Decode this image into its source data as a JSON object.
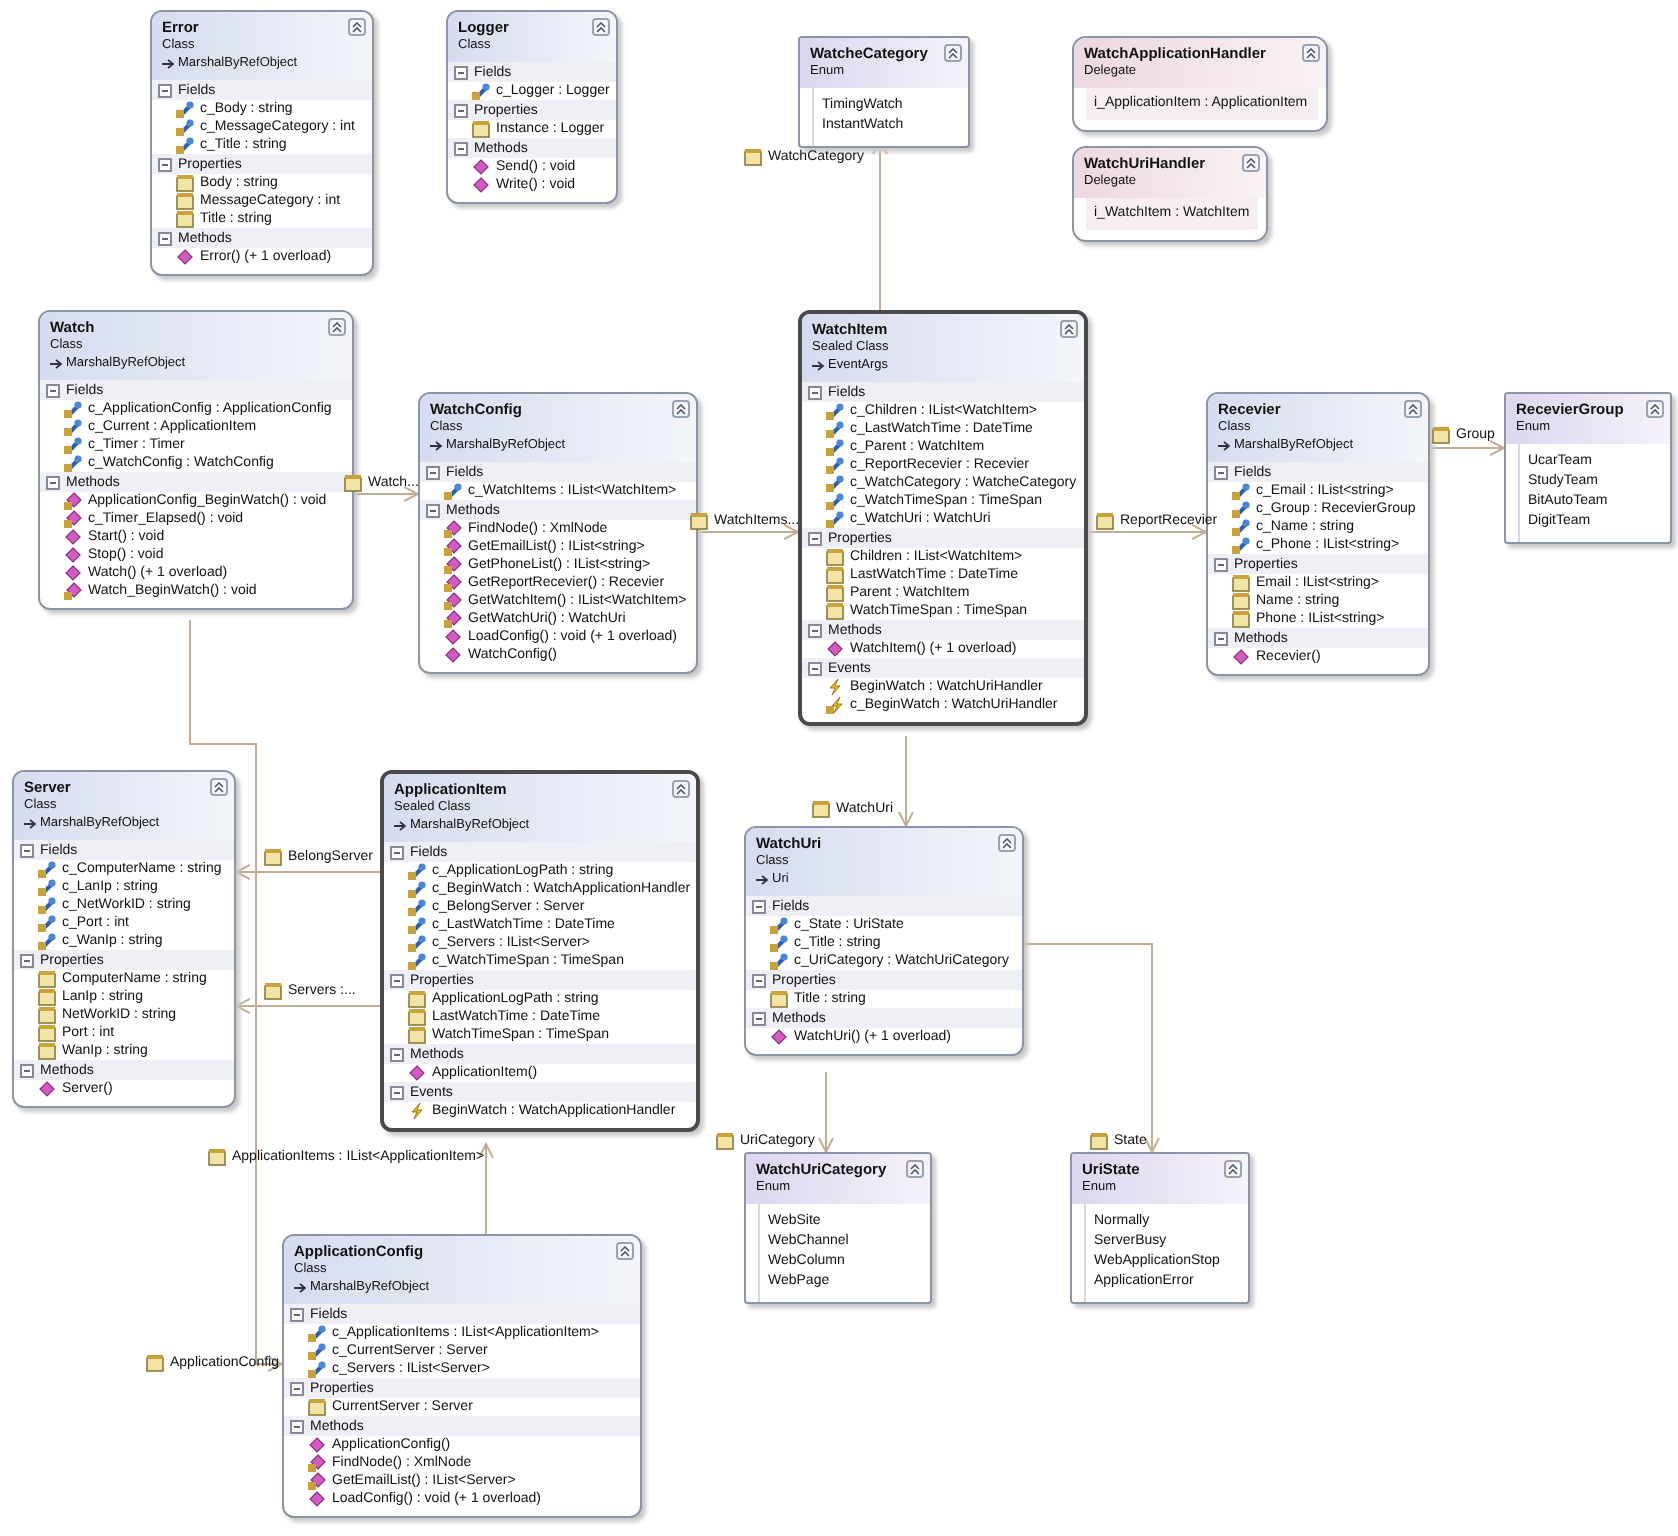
{
  "shapes": [
    {
      "kind": "class",
      "name": "Error",
      "stereotype": "Class",
      "base": "MarshalByRefObject",
      "selected": false,
      "sections": [
        {
          "title": "Fields",
          "members": [
            {
              "kind": "field",
              "text": "c_Body : string"
            },
            {
              "kind": "field",
              "text": "c_MessageCategory : int"
            },
            {
              "kind": "field",
              "text": "c_Title : string"
            }
          ]
        },
        {
          "title": "Properties",
          "members": [
            {
              "kind": "property",
              "text": "Body : string"
            },
            {
              "kind": "property",
              "text": "MessageCategory : int"
            },
            {
              "kind": "property",
              "text": "Title : string"
            }
          ]
        },
        {
          "title": "Methods",
          "members": [
            {
              "kind": "method",
              "text": "Error() (+ 1 overload)"
            }
          ]
        }
      ]
    },
    {
      "kind": "class",
      "name": "Logger",
      "stereotype": "Class",
      "selected": false,
      "sections": [
        {
          "title": "Fields",
          "members": [
            {
              "kind": "field",
              "text": "c_Logger : Logger"
            }
          ]
        },
        {
          "title": "Properties",
          "members": [
            {
              "kind": "property",
              "text": "Instance : Logger"
            }
          ]
        },
        {
          "title": "Methods",
          "members": [
            {
              "kind": "method",
              "text": "Send() : void"
            },
            {
              "kind": "method",
              "text": "Write() : void"
            }
          ]
        }
      ]
    },
    {
      "kind": "enum",
      "name": "WatcheCategory",
      "stereotype": "Enum",
      "selected": false,
      "values": [
        "TimingWatch",
        "InstantWatch"
      ]
    },
    {
      "kind": "delegate",
      "name": "WatchApplicationHandler",
      "stereotype": "Delegate",
      "selected": false,
      "values": [
        "i_ApplicationItem : ApplicationItem"
      ]
    },
    {
      "kind": "delegate",
      "name": "WatchUriHandler",
      "stereotype": "Delegate",
      "selected": false,
      "values": [
        "i_WatchItem : WatchItem"
      ]
    },
    {
      "kind": "class",
      "name": "Watch",
      "stereotype": "Class",
      "base": "MarshalByRefObject",
      "selected": false,
      "sections": [
        {
          "title": "Fields",
          "members": [
            {
              "kind": "field",
              "text": "c_ApplicationConfig : ApplicationConfig"
            },
            {
              "kind": "field",
              "text": "c_Current : ApplicationItem"
            },
            {
              "kind": "field",
              "text": "c_Timer : Timer"
            },
            {
              "kind": "field",
              "text": "c_WatchConfig : WatchConfig"
            }
          ]
        },
        {
          "title": "Methods",
          "members": [
            {
              "kind": "private-method",
              "text": "ApplicationConfig_BeginWatch() : void"
            },
            {
              "kind": "private-method",
              "text": "c_Timer_Elapsed() : void"
            },
            {
              "kind": "method",
              "text": "Start() : void"
            },
            {
              "kind": "method",
              "text": "Stop() : void"
            },
            {
              "kind": "method",
              "text": "Watch() (+ 1 overload)"
            },
            {
              "kind": "private-method",
              "text": "Watch_BeginWatch() : void"
            }
          ]
        }
      ]
    },
    {
      "kind": "class",
      "name": "WatchConfig",
      "stereotype": "Class",
      "base": "MarshalByRefObject",
      "selected": false,
      "sections": [
        {
          "title": "Fields",
          "members": [
            {
              "kind": "field",
              "text": "c_WatchItems : IList<WatchItem>"
            }
          ]
        },
        {
          "title": "Methods",
          "members": [
            {
              "kind": "private-method",
              "text": "FindNode() : XmlNode"
            },
            {
              "kind": "private-method",
              "text": "GetEmailList() : IList<string>"
            },
            {
              "kind": "private-method",
              "text": "GetPhoneList() : IList<string>"
            },
            {
              "kind": "private-method",
              "text": "GetReportRecevier() : Recevier"
            },
            {
              "kind": "private-method",
              "text": "GetWatchItem() : IList<WatchItem>"
            },
            {
              "kind": "private-method",
              "text": "GetWatchUri() : WatchUri"
            },
            {
              "kind": "method",
              "text": "LoadConfig() : void (+ 1 overload)"
            },
            {
              "kind": "method",
              "text": "WatchConfig()"
            }
          ]
        }
      ]
    },
    {
      "kind": "class",
      "name": "WatchItem",
      "stereotype": "Sealed Class",
      "base": "EventArgs",
      "selected": true,
      "sections": [
        {
          "title": "Fields",
          "members": [
            {
              "kind": "field",
              "text": "c_Children : IList<WatchItem>"
            },
            {
              "kind": "field",
              "text": "c_LastWatchTime : DateTime"
            },
            {
              "kind": "field",
              "text": "c_Parent : WatchItem"
            },
            {
              "kind": "field",
              "text": "c_ReportRecevier : Recevier"
            },
            {
              "kind": "field",
              "text": "c_WatchCategory : WatcheCategory"
            },
            {
              "kind": "field",
              "text": "c_WatchTimeSpan : TimeSpan"
            },
            {
              "kind": "field",
              "text": "c_WatchUri : WatchUri"
            }
          ]
        },
        {
          "title": "Properties",
          "members": [
            {
              "kind": "property",
              "text": "Children : IList<WatchItem>"
            },
            {
              "kind": "property",
              "text": "LastWatchTime : DateTime"
            },
            {
              "kind": "property",
              "text": "Parent : WatchItem"
            },
            {
              "kind": "property",
              "text": "WatchTimeSpan : TimeSpan"
            }
          ]
        },
        {
          "title": "Methods",
          "members": [
            {
              "kind": "method",
              "text": "WatchItem() (+ 1 overload)"
            }
          ]
        },
        {
          "title": "Events",
          "members": [
            {
              "kind": "event",
              "text": "BeginWatch : WatchUriHandler"
            },
            {
              "kind": "private-event",
              "text": "c_BeginWatch : WatchUriHandler"
            }
          ]
        }
      ]
    },
    {
      "kind": "class",
      "name": "Recevier",
      "stereotype": "Class",
      "base": "MarshalByRefObject",
      "selected": false,
      "sections": [
        {
          "title": "Fields",
          "members": [
            {
              "kind": "field",
              "text": "c_Email : IList<string>"
            },
            {
              "kind": "field",
              "text": "c_Group : RecevierGroup"
            },
            {
              "kind": "field",
              "text": "c_Name : string"
            },
            {
              "kind": "field",
              "text": "c_Phone : IList<string>"
            }
          ]
        },
        {
          "title": "Properties",
          "members": [
            {
              "kind": "property",
              "text": "Email : IList<string>"
            },
            {
              "kind": "property",
              "text": "Name : string"
            },
            {
              "kind": "property",
              "text": "Phone : IList<string>"
            }
          ]
        },
        {
          "title": "Methods",
          "members": [
            {
              "kind": "method",
              "text": "Recevier()"
            }
          ]
        }
      ]
    },
    {
      "kind": "enum",
      "name": "RecevierGroup",
      "stereotype": "Enum",
      "selected": false,
      "values": [
        "UcarTeam",
        "StudyTeam",
        "BitAutoTeam",
        "DigitTeam"
      ]
    },
    {
      "kind": "class",
      "name": "Server",
      "stereotype": "Class",
      "base": "MarshalByRefObject",
      "selected": false,
      "sections": [
        {
          "title": "Fields",
          "members": [
            {
              "kind": "field",
              "text": "c_ComputerName : string"
            },
            {
              "kind": "field",
              "text": "c_LanIp : string"
            },
            {
              "kind": "field",
              "text": "c_NetWorkID : string"
            },
            {
              "kind": "field",
              "text": "c_Port : int"
            },
            {
              "kind": "field",
              "text": "c_WanIp : string"
            }
          ]
        },
        {
          "title": "Properties",
          "members": [
            {
              "kind": "property",
              "text": "ComputerName : string"
            },
            {
              "kind": "property",
              "text": "LanIp : string"
            },
            {
              "kind": "property",
              "text": "NetWorkID : string"
            },
            {
              "kind": "property",
              "text": "Port : int"
            },
            {
              "kind": "property",
              "text": "WanIp : string"
            }
          ]
        },
        {
          "title": "Methods",
          "members": [
            {
              "kind": "method",
              "text": "Server()"
            }
          ]
        }
      ]
    },
    {
      "kind": "class",
      "name": "ApplicationItem",
      "stereotype": "Sealed Class",
      "base": "MarshalByRefObject",
      "selected": true,
      "sections": [
        {
          "title": "Fields",
          "members": [
            {
              "kind": "field",
              "text": "c_ApplicationLogPath : string"
            },
            {
              "kind": "field",
              "text": "c_BeginWatch : WatchApplicationHandler"
            },
            {
              "kind": "field",
              "text": "c_BelongServer : Server"
            },
            {
              "kind": "field",
              "text": "c_LastWatchTime : DateTime"
            },
            {
              "kind": "field",
              "text": "c_Servers : IList<Server>"
            },
            {
              "kind": "field",
              "text": "c_WatchTimeSpan : TimeSpan"
            }
          ]
        },
        {
          "title": "Properties",
          "members": [
            {
              "kind": "property",
              "text": "ApplicationLogPath : string"
            },
            {
              "kind": "property",
              "text": "LastWatchTime : DateTime"
            },
            {
              "kind": "property",
              "text": "WatchTimeSpan : TimeSpan"
            }
          ]
        },
        {
          "title": "Methods",
          "members": [
            {
              "kind": "method",
              "text": "ApplicationItem()"
            }
          ]
        },
        {
          "title": "Events",
          "members": [
            {
              "kind": "event",
              "text": "BeginWatch : WatchApplicationHandler"
            }
          ]
        }
      ]
    },
    {
      "kind": "class",
      "name": "WatchUri",
      "stereotype": "Class",
      "base": "Uri",
      "selected": false,
      "sections": [
        {
          "title": "Fields",
          "members": [
            {
              "kind": "field",
              "text": "c_State : UriState"
            },
            {
              "kind": "field",
              "text": "c_Title : string"
            },
            {
              "kind": "field",
              "text": "c_UriCategory : WatchUriCategory"
            }
          ]
        },
        {
          "title": "Properties",
          "members": [
            {
              "kind": "property",
              "text": "Title : string"
            }
          ]
        },
        {
          "title": "Methods",
          "members": [
            {
              "kind": "method",
              "text": "WatchUri() (+ 1 overload)"
            }
          ]
        }
      ]
    },
    {
      "kind": "enum",
      "name": "WatchUriCategory",
      "stereotype": "Enum",
      "selected": false,
      "values": [
        "WebSite",
        "WebChannel",
        "WebColumn",
        "WebPage"
      ]
    },
    {
      "kind": "enum",
      "name": "UriState",
      "stereotype": "Enum",
      "selected": false,
      "values": [
        "Normally",
        "ServerBusy",
        "WebApplicationStop",
        "ApplicationError"
      ]
    },
    {
      "kind": "class",
      "name": "ApplicationConfig",
      "stereotype": "Class",
      "base": "MarshalByRefObject",
      "selected": false,
      "sections": [
        {
          "title": "Fields",
          "members": [
            {
              "kind": "field",
              "text": "c_ApplicationItems : IList<ApplicationItem>"
            },
            {
              "kind": "field",
              "text": "c_CurrentServer : Server"
            },
            {
              "kind": "field",
              "text": "c_Servers : IList<Server>"
            }
          ]
        },
        {
          "title": "Properties",
          "members": [
            {
              "kind": "property",
              "text": "CurrentServer : Server"
            }
          ]
        },
        {
          "title": "Methods",
          "members": [
            {
              "kind": "method",
              "text": "ApplicationConfig()"
            },
            {
              "kind": "private-method",
              "text": "FindNode() : XmlNode"
            },
            {
              "kind": "private-method",
              "text": "GetEmailList() : IList<Server>"
            },
            {
              "kind": "method",
              "text": "LoadConfig() : void (+ 1 overload)"
            }
          ]
        }
      ]
    }
  ],
  "associations": [
    {
      "label": "WatchCategory"
    },
    {
      "label": "Watch..."
    },
    {
      "label": "WatchItems..."
    },
    {
      "label": "ReportRecevier"
    },
    {
      "label": "Group"
    },
    {
      "label": "WatchUri"
    },
    {
      "label": "BelongServer"
    },
    {
      "label": "Servers :..."
    },
    {
      "label": "ApplicationItems : IList<ApplicationItem>"
    },
    {
      "label": "ApplicationConfig"
    },
    {
      "label": "UriCategory"
    },
    {
      "label": "State"
    }
  ]
}
